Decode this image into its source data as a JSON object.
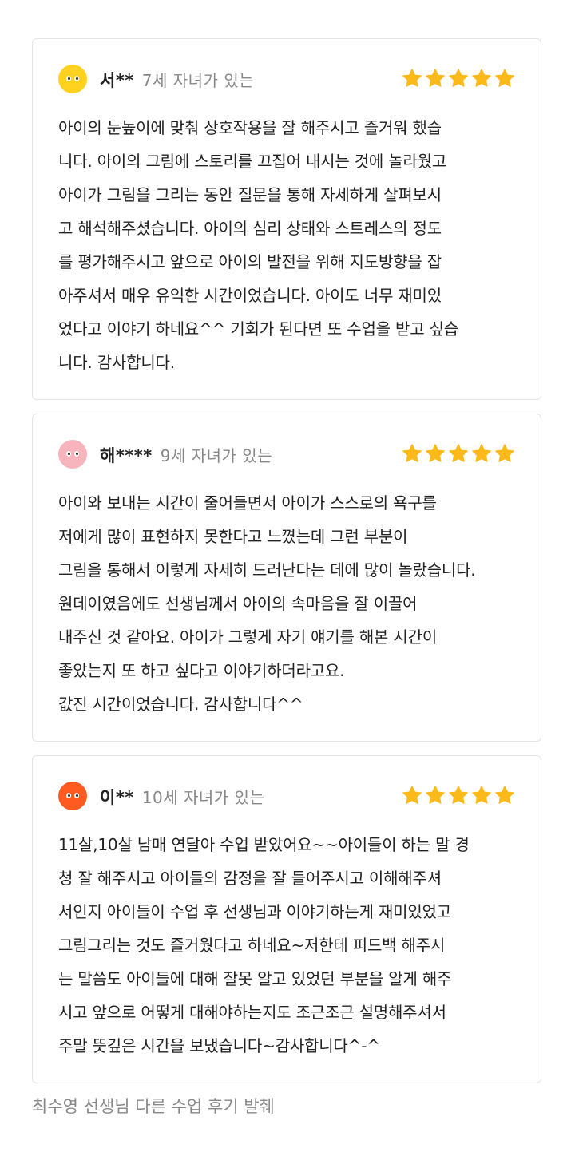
{
  "colors": {
    "star": "#FBBA1A",
    "card_border": "#E3E3E3",
    "muted_text": "#888888",
    "avatar_1": "#FFD21F",
    "avatar_2": "#F7B4BC",
    "avatar_3": "#FF5A1F"
  },
  "reviews": [
    {
      "name": "서**",
      "age": "7세 자녀가 있는",
      "rating": 5,
      "avatar_icon": "yellow-face-icon",
      "lines": [
        "아이의 눈높이에 맞춰 상호작용을 잘 해주시고 즐거워 했습",
        "니다. 아이의 그림에 스토리를 끄집어 내시는 것에 놀라웠고",
        "아이가 그림을 그리는 동안 질문을 통해 자세하게 살펴보시",
        "고 해석해주셨습니다. 아이의 심리 상태와 스트레스의 정도",
        "를 평가해주시고 앞으로 아이의 발전을 위해 지도방향을 잡",
        "아주셔서 매우 유익한 시간이었습니다. 아이도 너무 재미있",
        "었다고 이야기 하네요^^ 기회가 된다면 또 수업을 받고 싶습",
        "니다. 감사합니다."
      ]
    },
    {
      "name": "해****",
      "age": "9세 자녀가 있는",
      "rating": 5,
      "avatar_icon": "pink-face-icon",
      "lines": [
        "아이와 보내는 시간이 줄어들면서 아이가 스스로의 욕구를",
        "저에게 많이 표현하지 못한다고 느꼈는데 그런 부분이",
        "그림을 통해서 이렇게 자세히 드러난다는 데에 많이 놀랐습니다.",
        "원데이였음에도 선생님께서 아이의 속마음을 잘 이끌어",
        "내주신 것 같아요. 아이가 그렇게 자기 얘기를 해본 시간이",
        "좋았는지 또 하고 싶다고 이야기하더라고요.",
        "값진 시간이었습니다. 감사합니다^^"
      ]
    },
    {
      "name": "이**",
      "age": "10세 자녀가 있는",
      "rating": 5,
      "avatar_icon": "orange-face-icon",
      "lines": [
        "11살,10살 남매 연달아 수업 받았어요~~아이들이 하는 말 경",
        "청 잘 해주시고 아이들의 감정을 잘 들어주시고 이해해주셔",
        "서인지 아이들이 수업 후 선생님과 이야기하는게 재미있었고",
        "그림그리는 것도 즐거웠다고 하네요~저한테 피드백 해주시",
        "는 말씀도 아이들에 대해 잘못 알고 있었던 부분을 알게 해주",
        "시고 앞으로 어떻게 대해야하는지도 조근조근 설명해주셔서",
        "주말 뜻깊은 시간을 보냈습니다~감사합니다^-^"
      ]
    }
  ],
  "footer": "최수영 선생님 다른 수업 후기 발췌"
}
